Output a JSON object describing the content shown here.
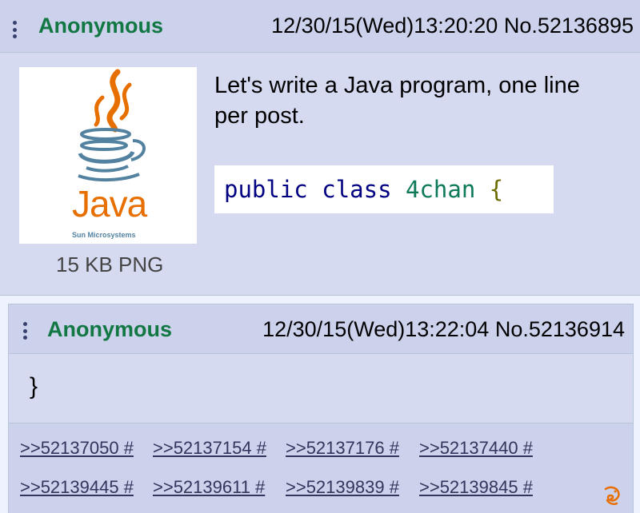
{
  "posts": [
    {
      "name": "Anonymous",
      "datetime": "12/30/15(Wed)13:20:20",
      "number": "No.52136895",
      "file_size": "15 KB PNG",
      "thumbnail": {
        "logo_word": "Java",
        "logo_sub": "Sun Microsystems"
      },
      "comment": "Let's write a Java program, one line per post.",
      "code": {
        "kw1": "public",
        "kw2": "class",
        "ident": "4chan",
        "brace": "{"
      }
    },
    {
      "name": "Anonymous",
      "datetime": "12/30/15(Wed)13:22:04",
      "number": "No.52136914",
      "comment": "}",
      "replies": [
        ">>52137050 #",
        ">>52137154 #",
        ">>52137176 #",
        ">>52137440 #",
        ">>52139445 #",
        ">>52139611 #",
        ">>52139839 #",
        ">>52139845 #"
      ]
    }
  ],
  "colors": {
    "name": "#117743",
    "post_bg": "#d6daf0",
    "header_bg": "#ccd1ec",
    "link": "#34345c",
    "java_orange": "#e76f00",
    "java_blue": "#5382a1"
  },
  "icons": [
    "menu-dots-icon",
    "fox-app-icon"
  ]
}
